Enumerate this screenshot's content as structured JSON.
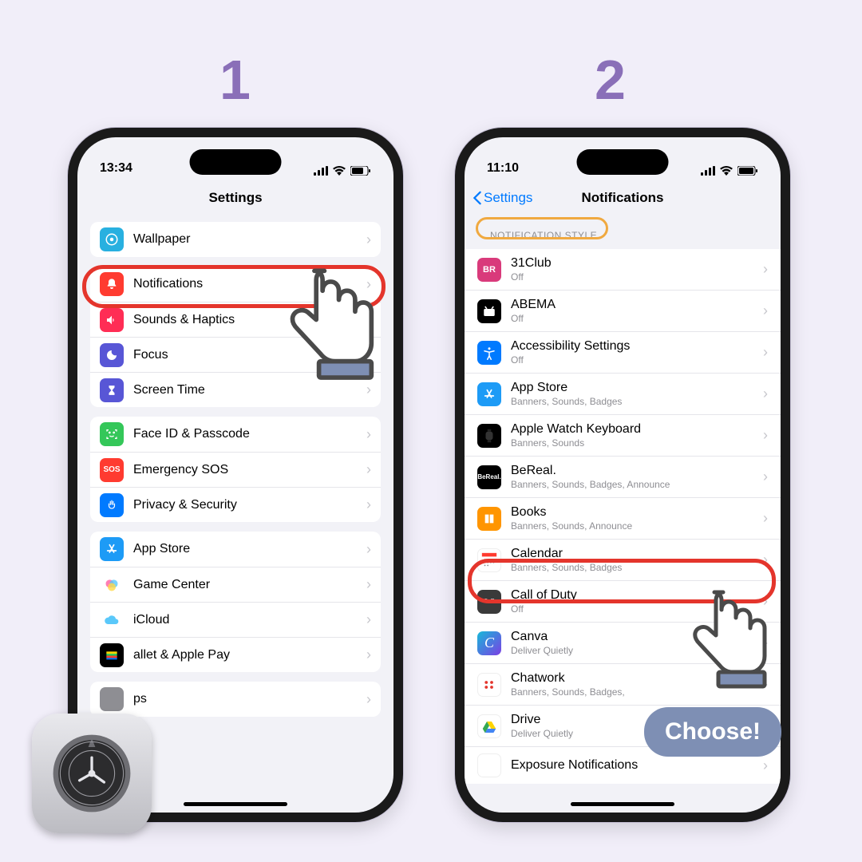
{
  "labels": {
    "step1": "1",
    "step2": "2",
    "choose": "Choose!"
  },
  "phone1": {
    "status": {
      "time": "13:34"
    },
    "nav": {
      "title": "Settings"
    },
    "partial_row": "Wallpaper",
    "group2": [
      {
        "title": "Notifications",
        "icon_bg": "#ff3b30",
        "glyph": "bell"
      },
      {
        "title": "Sounds & Haptics",
        "icon_bg": "#ff2d55",
        "glyph": "sound"
      },
      {
        "title": "Focus",
        "icon_bg": "#5856d6",
        "glyph": "moon"
      },
      {
        "title": "Screen Time",
        "icon_bg": "#5856d6",
        "glyph": "hourglass"
      }
    ],
    "group3": [
      {
        "title": "Face ID & Passcode",
        "icon_bg": "#34c759",
        "glyph": "face"
      },
      {
        "title": "Emergency SOS",
        "icon_bg": "#ff3b30",
        "glyph": "sos",
        "badge": "SOS"
      },
      {
        "title": "Privacy & Security",
        "icon_bg": "#007aff",
        "glyph": "hand"
      }
    ],
    "group4": [
      {
        "title": "App Store",
        "icon_bg": "#1d9bf6",
        "glyph": "A"
      },
      {
        "title": "Game Center",
        "icon_bg": "#ffffff",
        "glyph": "gc"
      },
      {
        "title": "iCloud",
        "icon_bg": "#ffffff",
        "glyph": "cloud"
      },
      {
        "title": "allet & Apple Pay",
        "icon_bg": "#000000",
        "glyph": "wallet"
      }
    ],
    "group5_clip": "ps"
  },
  "phone2": {
    "status": {
      "time": "11:10"
    },
    "nav": {
      "back": "Settings",
      "title": "Notifications"
    },
    "section": "NOTIFICATION STYLE",
    "apps": [
      {
        "title": "31Club",
        "sub": "Off",
        "icon_bg": "#d93a7b",
        "badge": "BR"
      },
      {
        "title": "ABEMA",
        "sub": "Off",
        "icon_bg": "#000000"
      },
      {
        "title": "Accessibility Settings",
        "sub": "Off",
        "icon_bg": "#007aff"
      },
      {
        "title": "App Store",
        "sub": "Banners, Sounds, Badges",
        "icon_bg": "#1d9bf6"
      },
      {
        "title": "Apple Watch Keyboard",
        "sub": "Banners, Sounds",
        "icon_bg": "#000000"
      },
      {
        "title": "BeReal.",
        "sub": "Banners, Sounds, Badges, Announce",
        "icon_bg": "#000000"
      },
      {
        "title": "Books",
        "sub": "Banners, Sounds, Announce",
        "icon_bg": "#ff9500"
      },
      {
        "title": "Calendar",
        "sub": "Banners, Sounds, Badges",
        "icon_bg": "#ffffff"
      },
      {
        "title": "Call of Duty",
        "sub": "Off",
        "icon_bg": "#3a3a3a"
      },
      {
        "title": "Canva",
        "sub": "Deliver Quietly",
        "icon_bg": "#17b9d9"
      },
      {
        "title": "Chatwork",
        "sub": "Banners, Sounds, Badges,",
        "icon_bg": "#ffffff"
      },
      {
        "title": "Drive",
        "sub": "Deliver Quietly",
        "icon_bg": "#ffffff"
      },
      {
        "title": "Exposure Notifications",
        "sub": "",
        "icon_bg": "#ffffff"
      }
    ]
  }
}
